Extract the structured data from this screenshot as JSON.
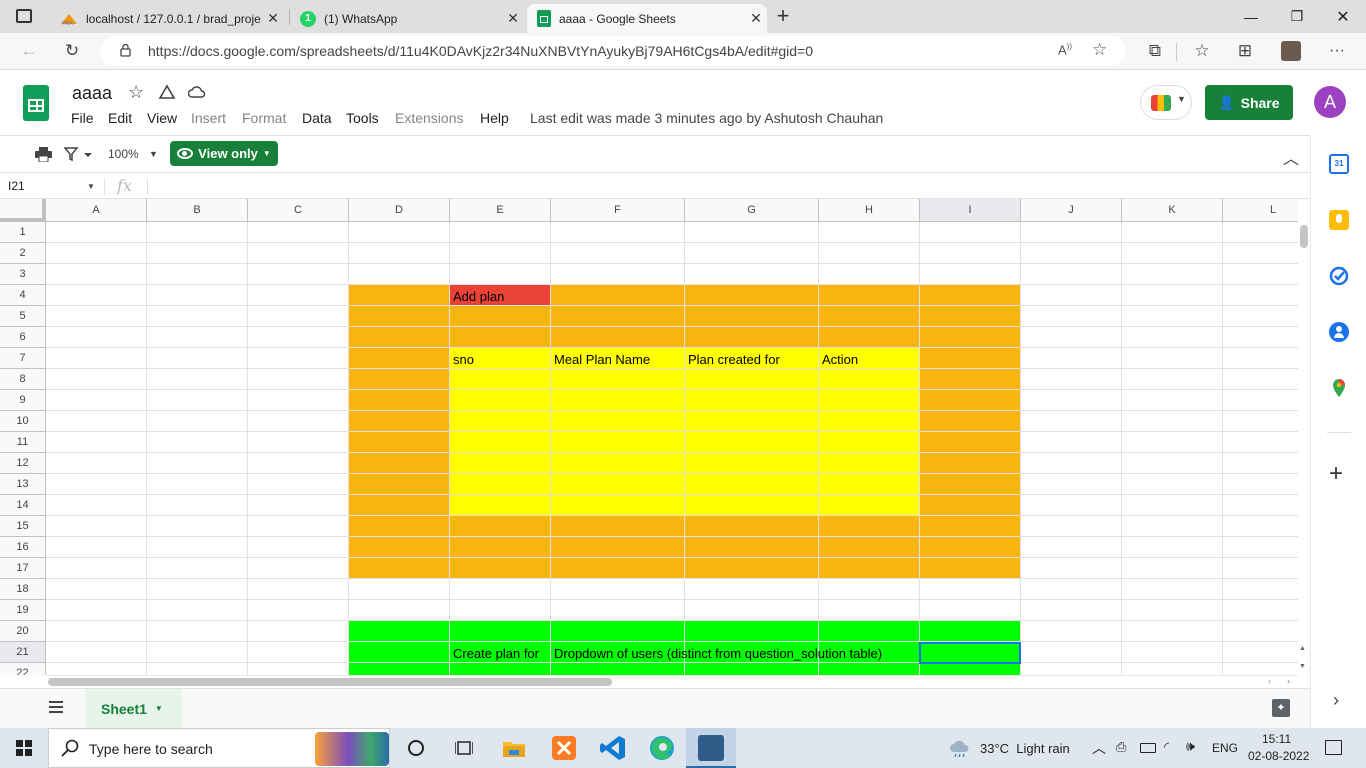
{
  "browser": {
    "tabs": [
      {
        "title": "localhost / 127.0.0.1 / brad_proje",
        "active": false
      },
      {
        "title": "(1) WhatsApp",
        "active": false
      },
      {
        "title": "aaaa - Google Sheets",
        "active": true
      }
    ],
    "url": "https://docs.google.com/spreadsheets/d/11u4K0DAvKjz2r34NuXNBVtYnAyukyBj79AH6tCgs4bA/edit#gid=0"
  },
  "sheets": {
    "doc_title": "aaaa",
    "menus": [
      "File",
      "Edit",
      "View",
      "Insert",
      "Format",
      "Data",
      "Tools",
      "Extensions",
      "Help"
    ],
    "last_edit": "Last edit was made 3 minutes ago by Ashutosh Chauhan",
    "share_label": "Share",
    "avatar_letter": "A",
    "zoom": "100%",
    "view_only_label": "View only",
    "cell_ref": "I21",
    "fx_label": "fx",
    "columns": [
      "A",
      "B",
      "C",
      "D",
      "E",
      "F",
      "G",
      "H",
      "I",
      "J",
      "K",
      "L"
    ],
    "rows": [
      "1",
      "2",
      "3",
      "4",
      "5",
      "6",
      "7",
      "8",
      "9",
      "10",
      "11",
      "12",
      "13",
      "14",
      "15",
      "16",
      "17",
      "18",
      "19",
      "20",
      "21",
      "22"
    ],
    "cells": {
      "add_plan": "Add plan",
      "sno": "sno",
      "meal_plan_name": "Meal Plan Name",
      "plan_created_for": "Plan created for",
      "action": "Action",
      "create_plan_for": "Create plan for",
      "dropdown_users": "Dropdown of users (distinct from question_solution table)"
    },
    "colors": {
      "orange": "#f9b50f",
      "yellow": "#ffff00",
      "red": "#ea4335",
      "green": "#00ff00",
      "selection": "#1a73e8"
    },
    "sheet_tab": "Sheet1"
  },
  "taskbar": {
    "search_placeholder": "Type here to search",
    "weather": "33°C  Light rain",
    "lang": "ENG",
    "time": "15:11",
    "date": "02-08-2022"
  }
}
